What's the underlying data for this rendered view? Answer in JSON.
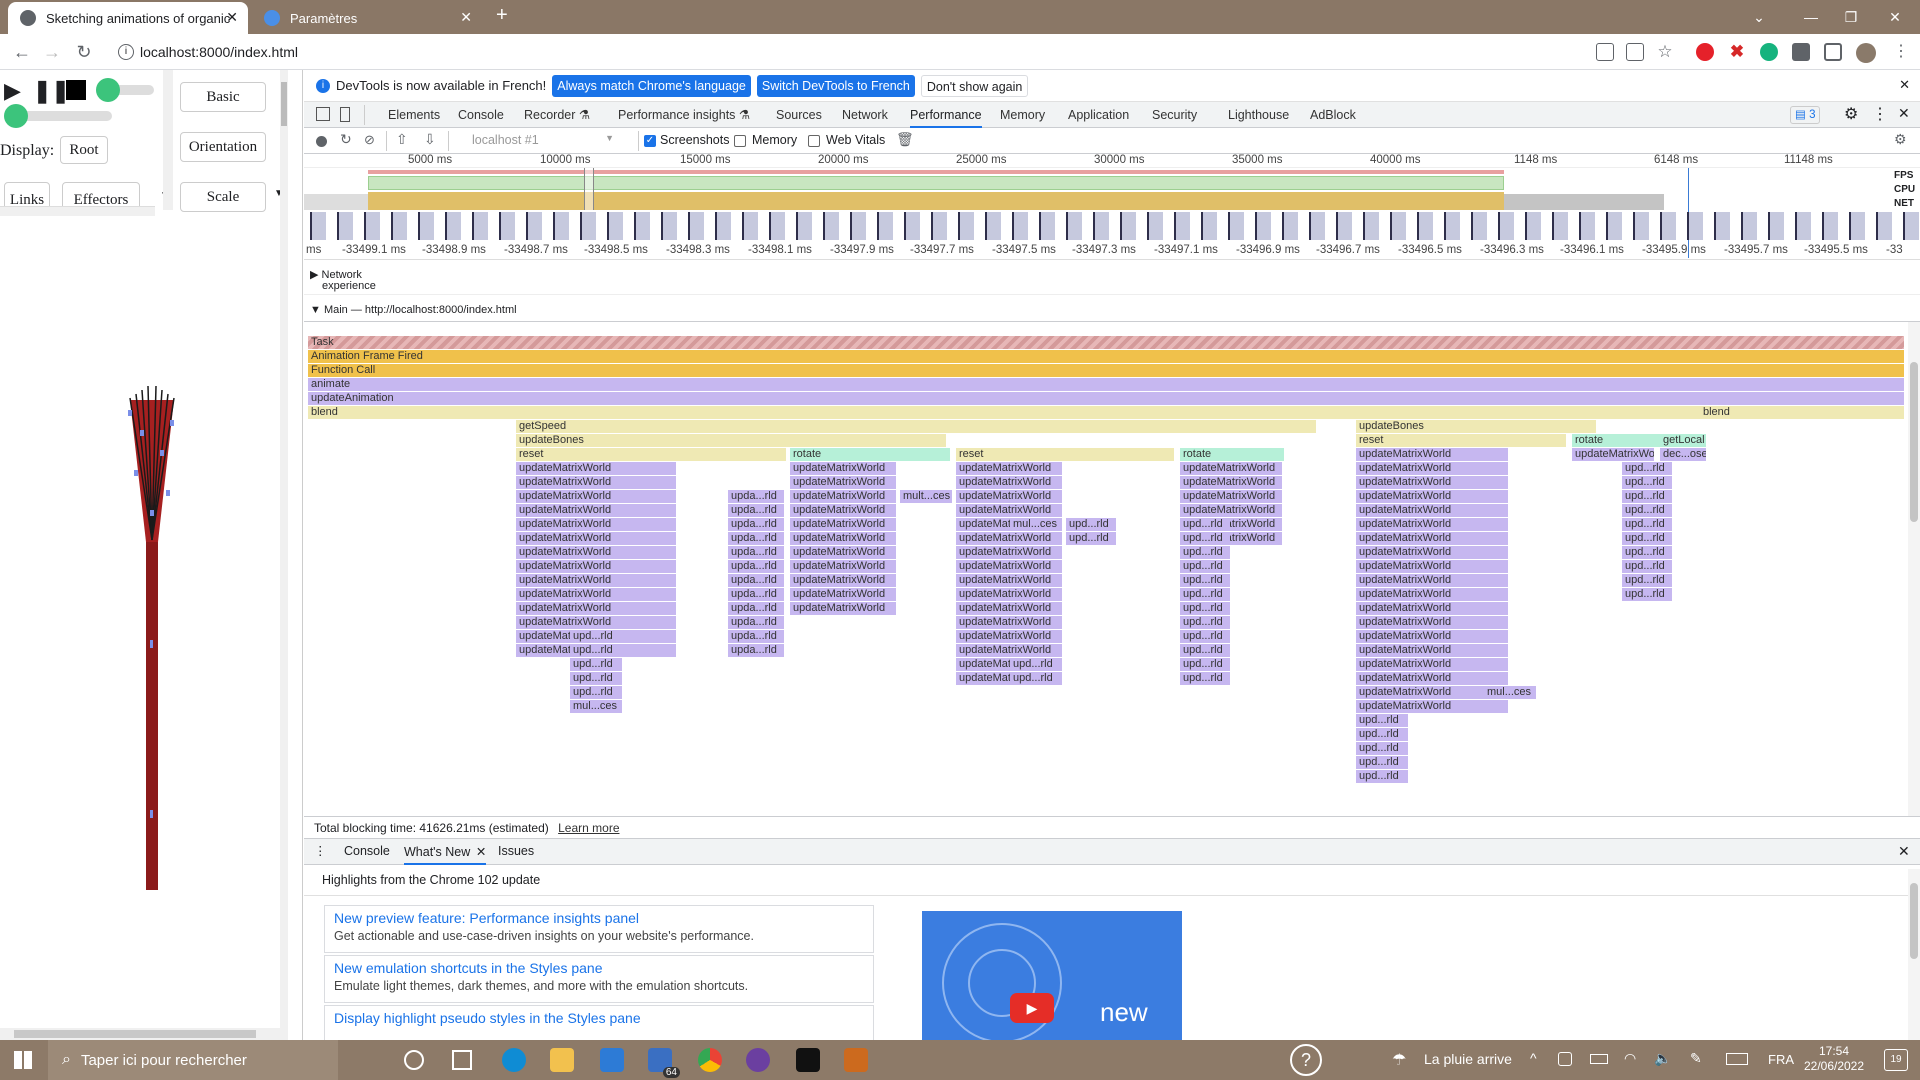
{
  "browser": {
    "tabs": [
      {
        "title": "Sketching animations of organic",
        "active": true
      },
      {
        "title": "Paramètres",
        "active": false
      }
    ],
    "new_tab": "+",
    "url": "localhost:8000/index.html"
  },
  "page": {
    "display_label": "Display:",
    "root_button": "Root",
    "basic_button": "Basic",
    "orientation_button": "Orientation",
    "scale_button": "Scale",
    "links_tab": "Links",
    "effectors_tab": "Effectors"
  },
  "devtools": {
    "infobar": {
      "message": "DevTools is now available in French!",
      "btn_match": "Always match Chrome's language",
      "btn_switch": "Switch DevTools to French",
      "btn_dismiss": "Don't show again"
    },
    "tabs": [
      "Elements",
      "Console",
      "Recorder ⚗",
      "Performance insights ⚗",
      "Sources",
      "Network",
      "Performance",
      "Memory",
      "Application",
      "Security",
      "Lighthouse",
      "AdBlock"
    ],
    "selected_tab": "Performance",
    "issues_count": "3",
    "perf_toolbar": {
      "target": "localhost #1",
      "screenshots": "Screenshots",
      "memory": "Memory",
      "web_vitals": "Web Vitals"
    },
    "overview_ticks": [
      "5000 ms",
      "10000 ms",
      "15000 ms",
      "20000 ms",
      "25000 ms",
      "30000 ms",
      "35000 ms",
      "40000 ms",
      "1148 ms",
      "6148 ms",
      "11148 ms"
    ],
    "overview_labels": [
      "FPS",
      "CPU",
      "NET"
    ],
    "ruler_ticks": [
      "ms",
      "-33499.1 ms",
      "-33498.9 ms",
      "-33498.7 ms",
      "-33498.5 ms",
      "-33498.3 ms",
      "-33498.1 ms",
      "-33497.9 ms",
      "-33497.7 ms",
      "-33497.5 ms",
      "-33497.3 ms",
      "-33497.1 ms",
      "-33496.9 ms",
      "-33496.7 ms",
      "-33496.5 ms",
      "-33496.3 ms",
      "-33496.1 ms",
      "-33495.9 ms",
      "-33495.7 ms",
      "-33495.5 ms",
      "-33"
    ],
    "network_track": "Network",
    "experience_track": "experience",
    "main_track": "Main — http://localhost:8000/index.html",
    "full_rows": [
      "Task",
      "Animation Frame Fired",
      "Function Call",
      "animate",
      "updateAnimation"
    ],
    "blend_labels": [
      "blend",
      "blend"
    ],
    "status_text": "Total blocking time: 41626.21ms (estimated)",
    "learn_more": "Learn more",
    "drawer_tabs": [
      "Console",
      "What's New",
      "Issues"
    ],
    "drawer_heading": "Highlights from the Chrome 102 update",
    "whats_new": [
      {
        "title": "New preview feature: Performance insights panel",
        "desc": "Get actionable and use-case-driven insights on your website's performance."
      },
      {
        "title": "New emulation shortcuts in the Styles pane",
        "desc": "Emulate light themes, dark themes, and more with the emulation shortcuts."
      },
      {
        "title": "Display highlight pseudo styles in the Styles pane",
        "desc": ""
      }
    ],
    "video_label": "new"
  },
  "taskbar": {
    "search_placeholder": "Taper ici pour rechercher",
    "weather": "La pluie arrive",
    "lang": "FRA",
    "time": "17:54",
    "date": "22/06/2022",
    "mail_badge": "64",
    "notif_badge": "19"
  },
  "colors": {
    "accent": "#1a73e8",
    "task": "#d9a6a6",
    "frame": "#f0c14b",
    "function": "#f0c14b",
    "script": "#c6b7f0",
    "blend": "#efe9b4",
    "rotate": "#b6f0d8"
  }
}
